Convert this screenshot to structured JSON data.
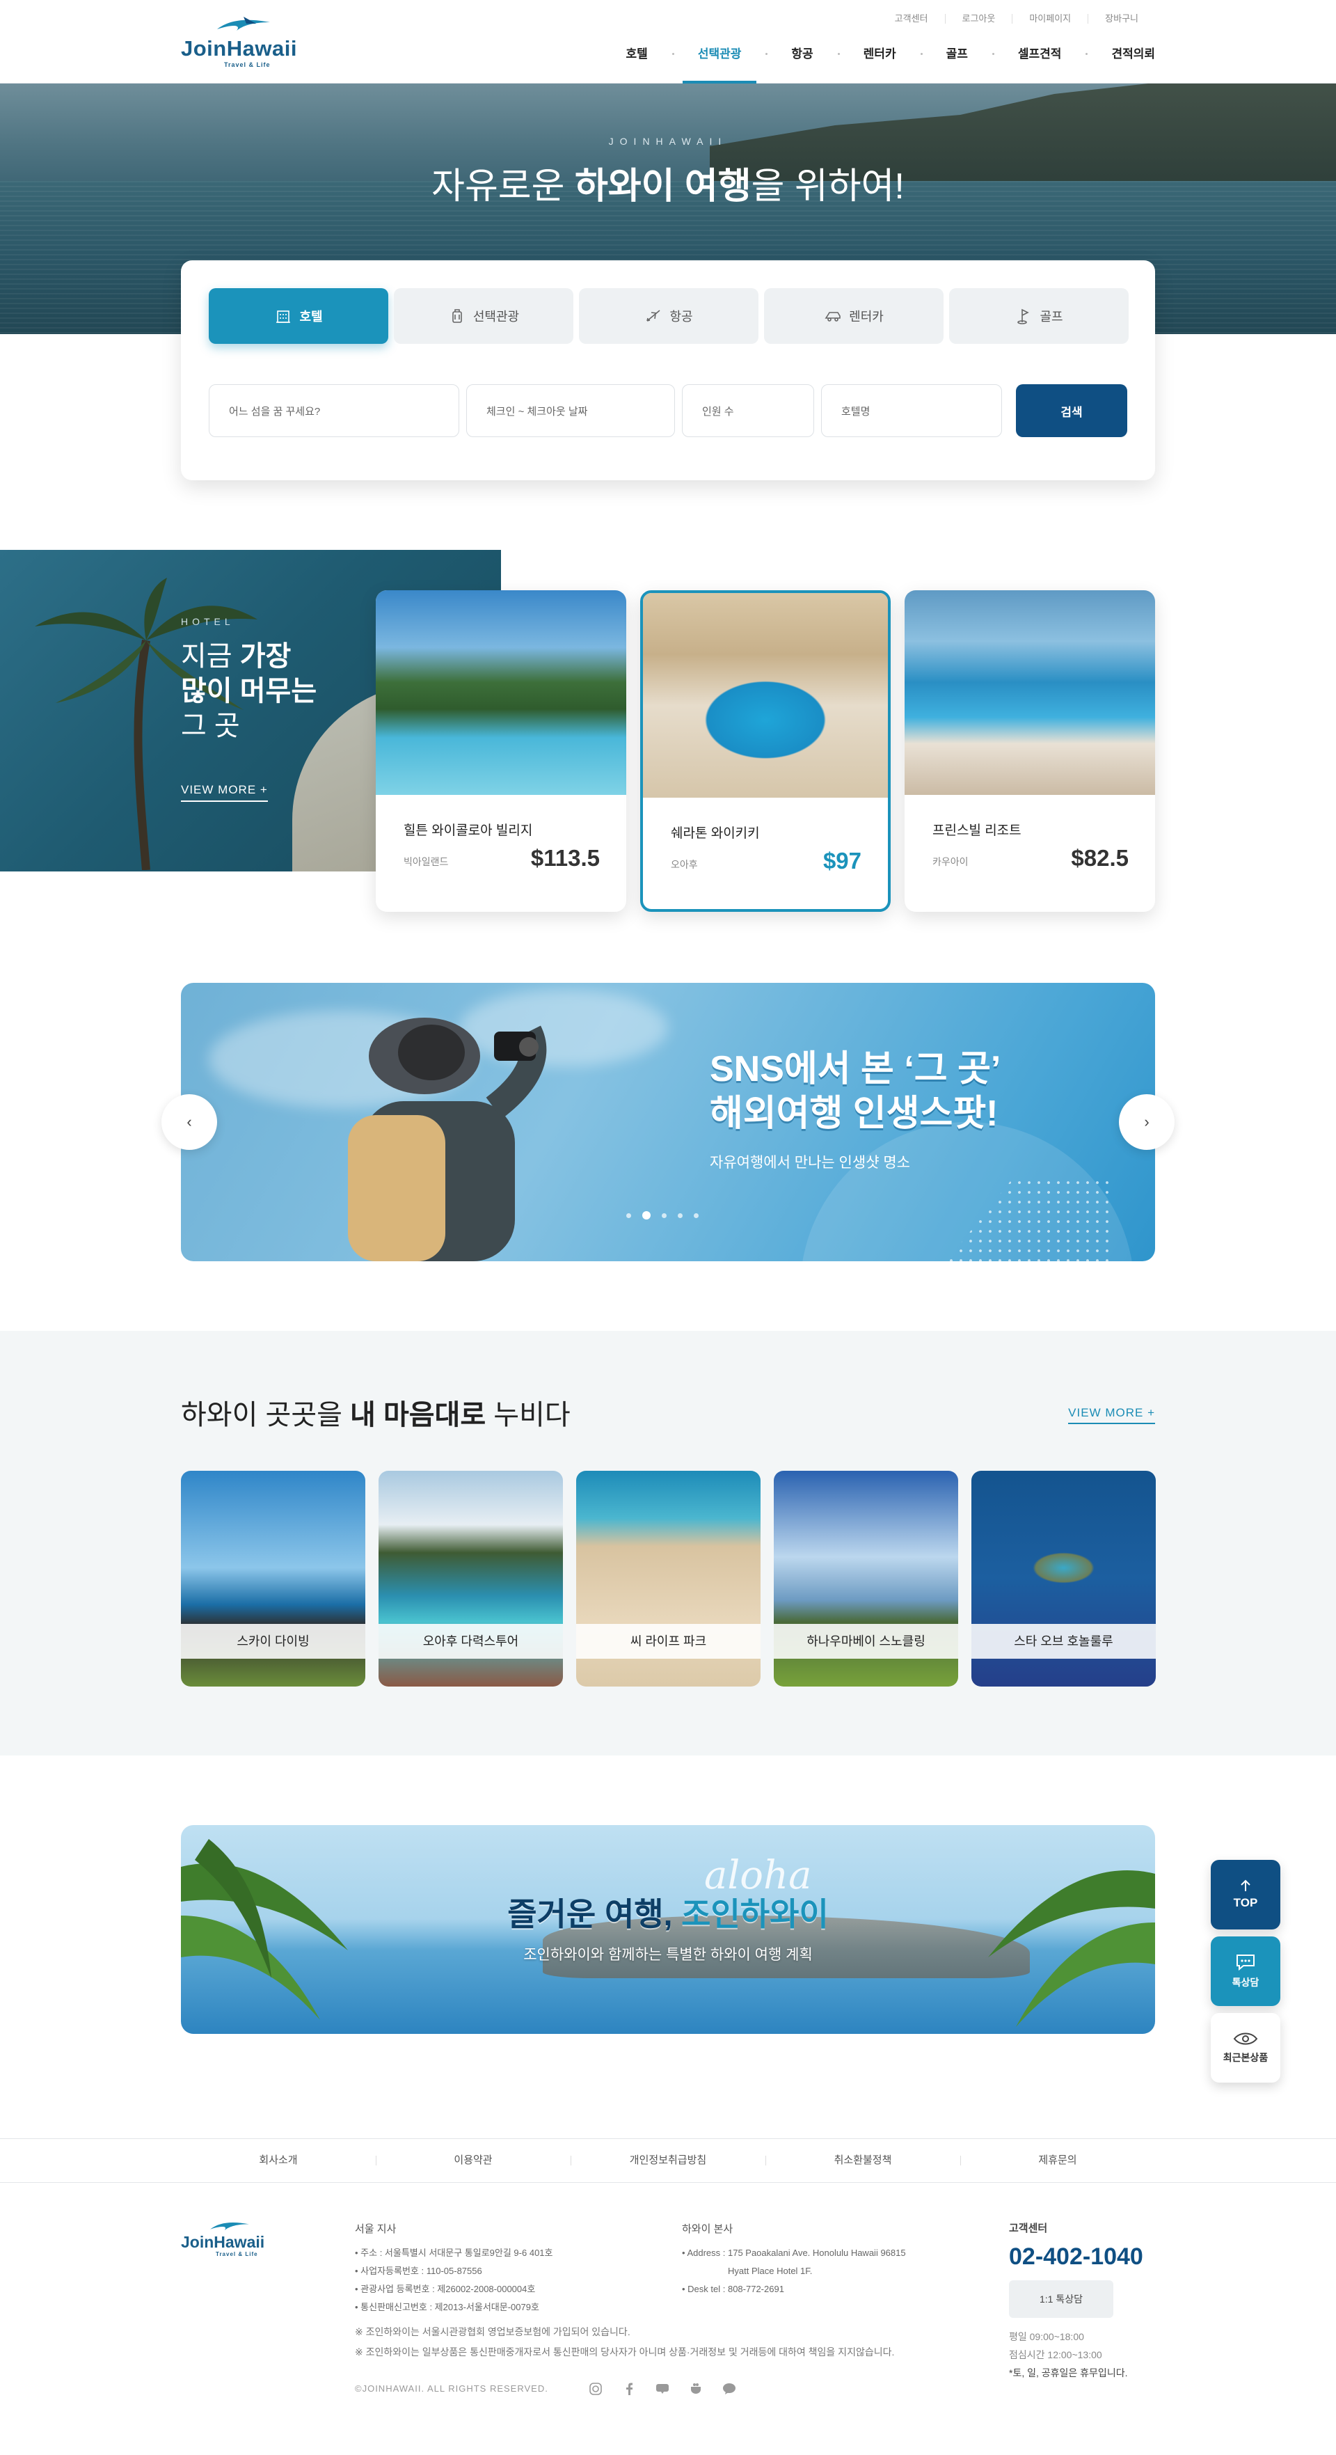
{
  "header": {
    "logo_text": "JoinHawaii",
    "logo_tagline": "Travel & Life",
    "util_links": [
      "고객센터",
      "로그아웃",
      "마이페이지",
      "장바구니"
    ],
    "gnb": [
      "호텔",
      "선택관광",
      "항공",
      "렌터카",
      "골프",
      "셀프견적",
      "견적의뢰"
    ],
    "gnb_active": "선택관광"
  },
  "hero": {
    "eyebrow": "JOINHAWAII",
    "title_pre": "자유로운 ",
    "title_bold": "하와이 여행",
    "title_post": "을 위하여!"
  },
  "search": {
    "tabs": [
      {
        "label": "호텔",
        "icon": "hotel-icon"
      },
      {
        "label": "선택관광",
        "icon": "luggage-icon"
      },
      {
        "label": "항공",
        "icon": "plane-icon"
      },
      {
        "label": "렌터카",
        "icon": "car-icon"
      },
      {
        "label": "골프",
        "icon": "golf-icon"
      }
    ],
    "destination_placeholder": "어느 섬을 꿈 꾸세요?",
    "dates_placeholder": "체크인 ~ 체크아웃 날짜",
    "guests_placeholder": "인원 수",
    "hotel_placeholder": "호텔명",
    "search_label": "검색"
  },
  "hotels": {
    "eyebrow": "HOTEL",
    "title_line1_pre": "지금 ",
    "title_line1_bold": "가장",
    "title_line2": "많이 머무는",
    "title_line3": "그 곳",
    "more": "VIEW MORE +",
    "cards": [
      {
        "name": "힐튼 와이콜로아 빌리지",
        "location": "빅아일랜드",
        "price": "$113.5"
      },
      {
        "name": "쉐라톤 와이키키",
        "location": "오아후",
        "price": "$97"
      },
      {
        "name": "프린스빌 리조트",
        "location": "카우아이",
        "price": "$82.5"
      }
    ]
  },
  "carousel": {
    "headline_line1": "SNS에서 본 ‘그 곳’",
    "headline_line2": "해외여행 인생스팟!",
    "sub": "자유여행에서 만나는 인생샷 명소",
    "slide_count": 5,
    "active_slide": 2
  },
  "spots": {
    "title_pre": "하와이 곳곳을 ",
    "title_bold": "내 마음대로",
    "title_post": " 누비다",
    "more": "VIEW MORE +",
    "items": [
      "스카이 다이빙",
      "오아후 다력스투어",
      "씨 라이프 파크",
      "하나우마베이 스노클링",
      "스타 오브 호놀룰루"
    ]
  },
  "promo": {
    "title_pre": "즐거운 여행, ",
    "title_accent": "조인하와이",
    "sub": "조인하와이와 함께하는 특별한 하와이 여행 계획",
    "script": "aloha"
  },
  "quick": {
    "top": "TOP",
    "chat": "톡상담",
    "recent": "최근본상품"
  },
  "footer": {
    "nav": [
      "회사소개",
      "이용약관",
      "개인정보취급방침",
      "취소환불정책",
      "제휴문의"
    ],
    "seoul_title": "서울 지사",
    "seoul_lines": [
      "주소 : 서울특별시 서대문구 통일로9안길 9-6 401호",
      "사업자등록번호 : 110-05-87556",
      "관광사업 등록번호 : 제26002-2008-000004호",
      "통신판매신고번호 : 제2013-서울서대문-0079호"
    ],
    "hawaii_title": "하와이 본사",
    "hawaii_lines": [
      "Address : 175 Paoakalani Ave. Honolulu Hawaii 96815",
      "Hyatt Place Hotel 1F.",
      "Desk tel : 808-772-2691"
    ],
    "notes": [
      "※ 조인하와이는 서울시관광협회 영업보증보험에 가입되어 있습니다.",
      "※ 조인하와이는 일부상품은 통신판매중개자로서 통신판매의 당사자가 아니며 상품·거래정보 및 거래등에 대하여 책임을 지지않습니다."
    ],
    "copyright": "©JOINHAWAII. ALL RIGHTS RESERVED.",
    "cs_title": "고객센터",
    "cs_tel": "02-402-1040",
    "cs_button": "1:1 톡상담",
    "hours_weekday": "평일 09:00~18:00",
    "hours_lunch": "점심시간 12:00~13:00",
    "hours_holiday": "*토, 일, 공휴일은 휴무입니다."
  }
}
